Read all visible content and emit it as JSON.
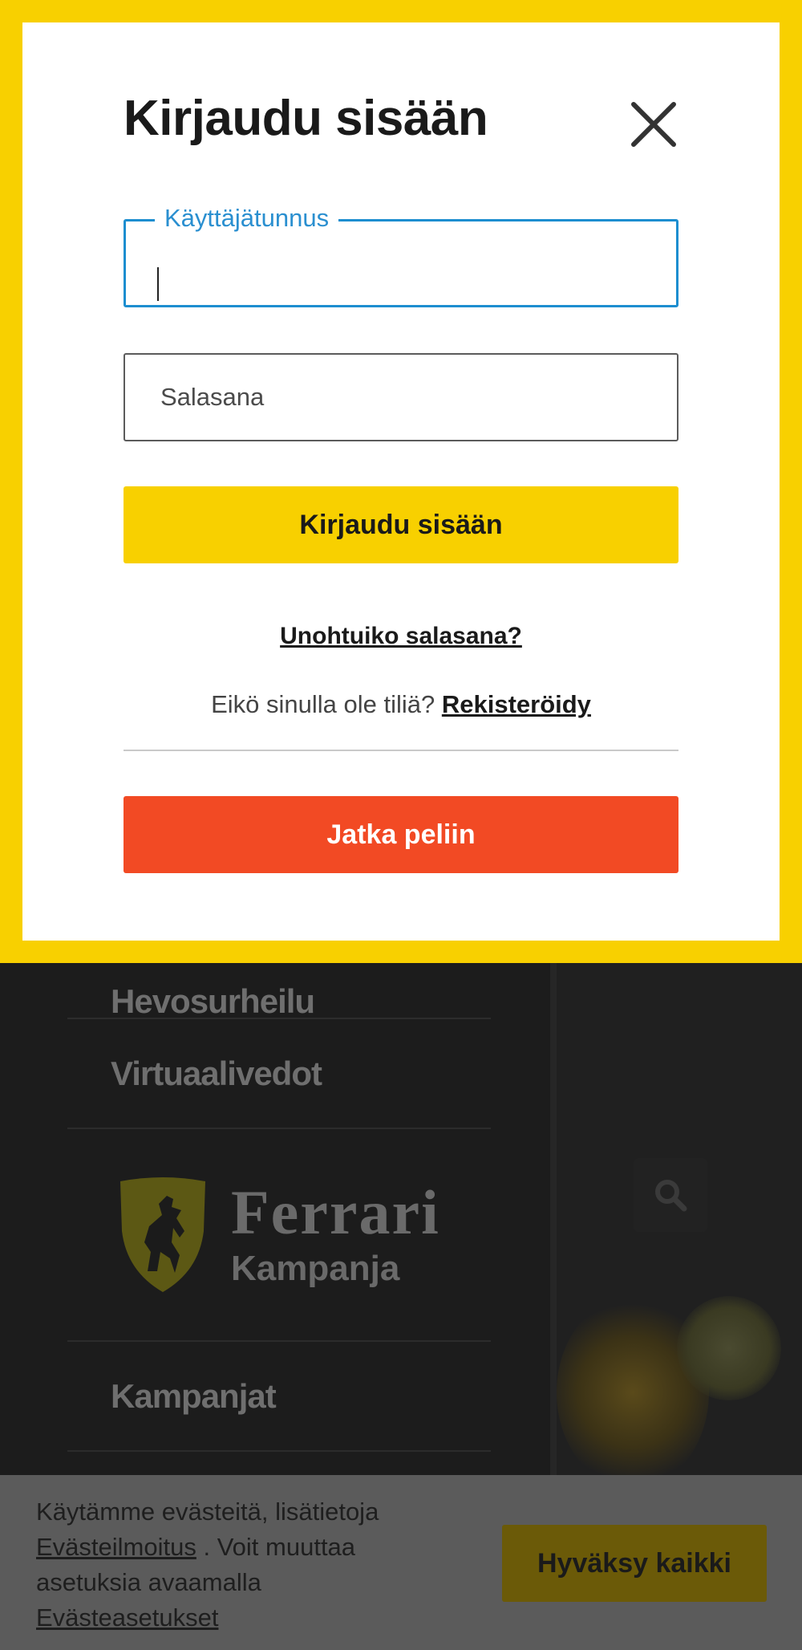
{
  "modal": {
    "title": "Kirjaudu sisään",
    "username_label": "Käyttäjätunnus",
    "username_value": "",
    "password_placeholder": "Salasana",
    "login_button": "Kirjaudu sisään",
    "forgot_password": "Unohtuiko salasana?",
    "register_prompt": "Eikö sinulla ole tiliä?",
    "register_link": "Rekisteröidy",
    "continue_button": "Jatka peliin",
    "close_icon": "close-icon"
  },
  "background_menu": {
    "items": [
      "Hevosurheilu",
      "Virtuaalivedot",
      "Kampanjat"
    ],
    "ferrari": {
      "brand": "Ferrari",
      "sub": "Kampanja"
    },
    "search_icon": "search-icon"
  },
  "cookie_bar": {
    "text_1": "Käytämme evästeitä, lisätietoja",
    "link_1": "Evästeilmoitus",
    "text_2": ". Voit muuttaa asetuksia avaamalla",
    "link_2": "Evästeasetukset",
    "accept_button": "Hyväksy kaikki"
  },
  "colors": {
    "brand_yellow": "#f8d000",
    "continue_red": "#f24a24",
    "focus_blue": "#1d8ed0"
  }
}
